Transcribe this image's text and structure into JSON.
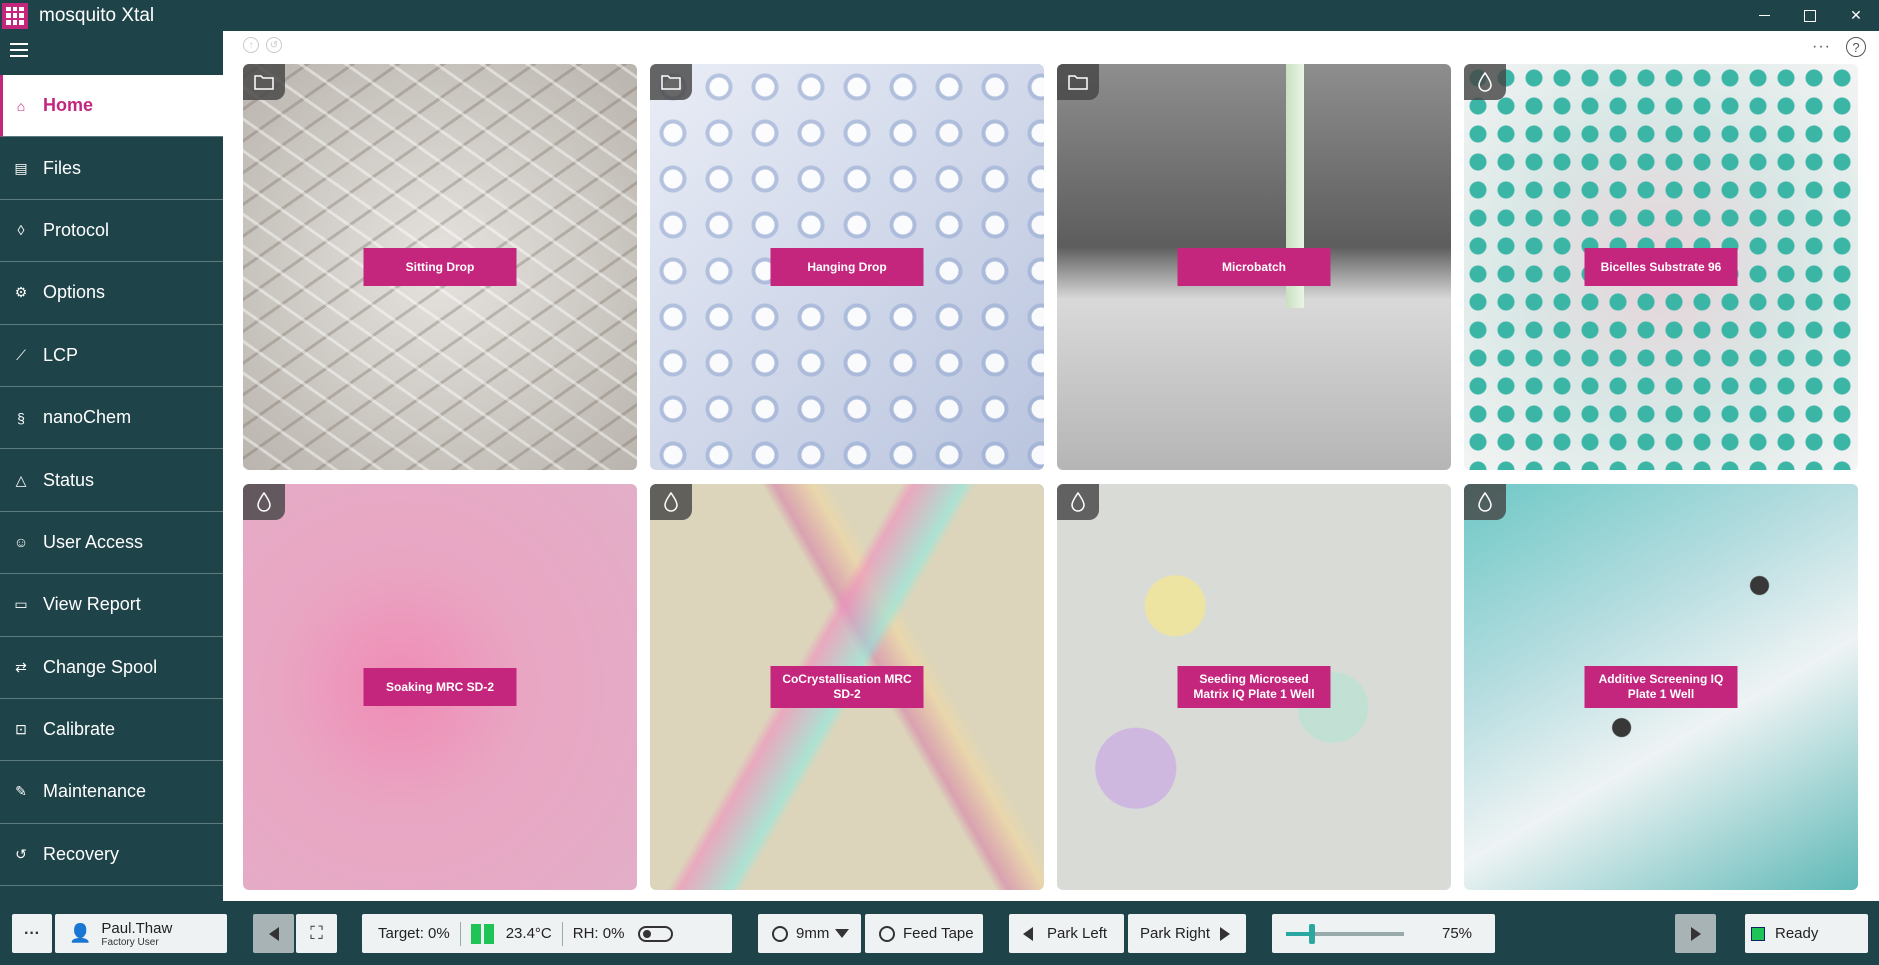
{
  "app": {
    "title": "mosquito Xtal",
    "accent": "#c4267d",
    "sidebar_bg": "#1e4349"
  },
  "window_controls": [
    "minimize-icon",
    "maximize-icon",
    "close-icon"
  ],
  "sidebar": {
    "items": [
      {
        "label": "Home",
        "icon": "home-icon",
        "active": true
      },
      {
        "label": "Files",
        "icon": "files-icon"
      },
      {
        "label": "Protocol",
        "icon": "drop-icon"
      },
      {
        "label": "Options",
        "icon": "gear-icon"
      },
      {
        "label": "LCP",
        "icon": "syringe-icon"
      },
      {
        "label": "nanoChem",
        "icon": "dna-icon"
      },
      {
        "label": "Status",
        "icon": "warning-icon"
      },
      {
        "label": "User Access",
        "icon": "users-icon"
      },
      {
        "label": "View Report",
        "icon": "report-icon"
      },
      {
        "label": "Change Spool",
        "icon": "swap-icon"
      },
      {
        "label": "Calibrate",
        "icon": "calibrate-icon"
      },
      {
        "label": "Maintenance",
        "icon": "wrench-icon"
      },
      {
        "label": "Recovery",
        "icon": "undo-icon"
      }
    ]
  },
  "tiles": [
    {
      "label": "Sitting Drop",
      "badge": "folder-icon"
    },
    {
      "label": "Hanging Drop",
      "badge": "folder-icon"
    },
    {
      "label": "Microbatch",
      "badge": "folder-icon"
    },
    {
      "label": "Bicelles Substrate 96",
      "badge": "drop-icon"
    },
    {
      "label": "Soaking MRC SD-2",
      "badge": "drop-icon"
    },
    {
      "label": "CoCrystallisation MRC SD-2",
      "badge": "drop-icon"
    },
    {
      "label": "Seeding Microseed Matrix IQ Plate 1 Well",
      "badge": "drop-icon"
    },
    {
      "label": "Additive Screening IQ Plate 1 Well",
      "badge": "drop-icon"
    }
  ],
  "bottom": {
    "more": "···",
    "user": {
      "name": "Paul.Thaw",
      "role": "Factory User"
    },
    "env": {
      "target": "Target: 0%",
      "temperature": "23.4°C",
      "rh": "RH: 0%"
    },
    "tape": {
      "size": "9mm",
      "feed_label": "Feed Tape"
    },
    "park": {
      "left": "Park Left",
      "right": "Park Right"
    },
    "speed": {
      "value": "75%",
      "fraction": 0.22
    },
    "status": {
      "label": "Ready",
      "color": "#1ec456"
    }
  }
}
